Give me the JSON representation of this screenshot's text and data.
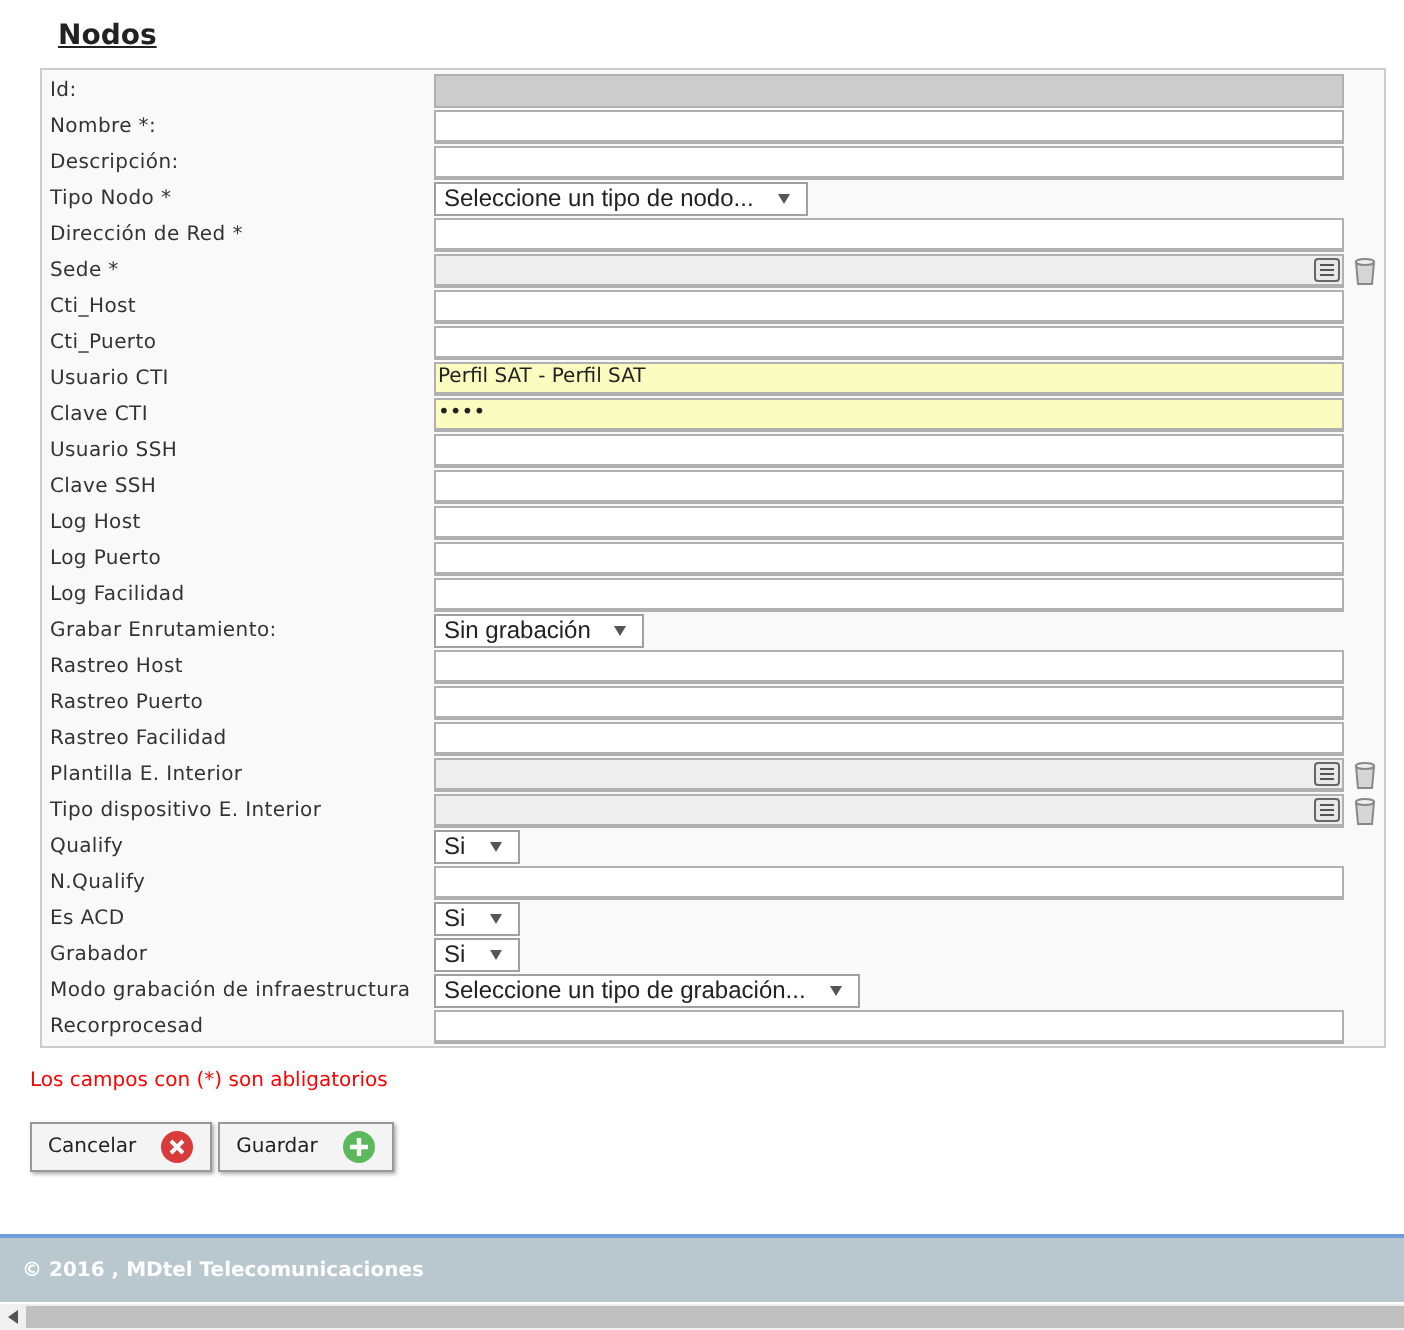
{
  "title": "Nodos",
  "fields": [
    {
      "label": "Id:",
      "kind": "readonly",
      "highlighted": false
    },
    {
      "label": "Nombre *:",
      "kind": "text",
      "highlighted": false
    },
    {
      "label": "Descripción:",
      "kind": "text",
      "highlighted": false
    },
    {
      "label": "Tipo Nodo *",
      "kind": "select",
      "value": "Seleccione un tipo de nodo...",
      "highlighted": false
    },
    {
      "label": "Dirección de Red *",
      "kind": "text",
      "highlighted": false
    },
    {
      "label": "Sede *",
      "kind": "lookup",
      "highlighted": false
    },
    {
      "label": "Cti_Host",
      "kind": "text",
      "highlighted": false
    },
    {
      "label": "Cti_Puerto",
      "kind": "text",
      "highlighted": false
    },
    {
      "label": "Usuario CTI",
      "kind": "text",
      "value": "Perfil SAT - Perfil SAT",
      "highlighted": true
    },
    {
      "label": "Clave CTI",
      "kind": "text",
      "value": "••••",
      "highlighted": true
    },
    {
      "label": "Usuario SSH",
      "kind": "text",
      "highlighted": false
    },
    {
      "label": "Clave SSH",
      "kind": "text",
      "highlighted": false
    },
    {
      "label": "Log Host",
      "kind": "text",
      "highlighted": false
    },
    {
      "label": "Log Puerto",
      "kind": "text",
      "highlighted": false
    },
    {
      "label": "Log Facilidad",
      "kind": "text",
      "highlighted": false
    },
    {
      "label": "Grabar Enrutamiento:",
      "kind": "select",
      "value": "Sin grabación",
      "highlighted": false
    },
    {
      "label": "Rastreo Host",
      "kind": "text",
      "highlighted": false
    },
    {
      "label": "Rastreo Puerto",
      "kind": "text",
      "highlighted": false
    },
    {
      "label": "Rastreo Facilidad",
      "kind": "text",
      "highlighted": false
    },
    {
      "label": "Plantilla E. Interior",
      "kind": "lookup",
      "highlighted": false
    },
    {
      "label": "Tipo dispositivo E. Interior",
      "kind": "lookup",
      "highlighted": false
    },
    {
      "label": "Qualify",
      "kind": "select",
      "value": "Si",
      "highlighted": false
    },
    {
      "label": "N.Qualify",
      "kind": "text",
      "highlighted": false
    },
    {
      "label": "Es ACD",
      "kind": "select",
      "value": "Si",
      "highlighted": false
    },
    {
      "label": "Grabador",
      "kind": "select",
      "value": "Si",
      "highlighted": false
    },
    {
      "label": "Modo grabación de infraestructura",
      "kind": "select",
      "value": "Seleccione un tipo de grabación...",
      "highlighted": false
    },
    {
      "label": "Recorprocesad",
      "kind": "text",
      "highlighted": false
    }
  ],
  "required_note": "Los campos con (*) son abligatorios",
  "buttons": [
    {
      "label": "Cancelar",
      "kind": "cancel"
    },
    {
      "label": "Guardar",
      "kind": "save"
    }
  ],
  "footer": "© 2016 , MDtel Telecomunicaciones"
}
